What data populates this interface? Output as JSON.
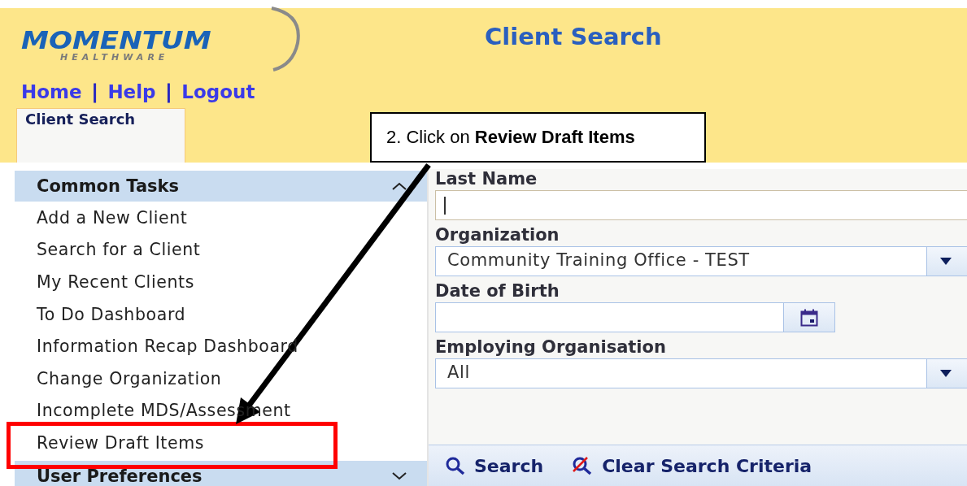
{
  "logo": {
    "name": "MOMENTUM",
    "tagline": "HEALTHWARE"
  },
  "page_title": "Client Search",
  "nav": [
    {
      "kind": "link",
      "text": "Home"
    },
    {
      "kind": "separator",
      "text": "|"
    },
    {
      "kind": "link",
      "text": "Help"
    },
    {
      "kind": "separator",
      "text": "|"
    },
    {
      "kind": "link",
      "text": "Logout"
    }
  ],
  "tabs": [
    {
      "label": "Client Search",
      "selected": true
    }
  ],
  "sidebar": {
    "sections": [
      {
        "title": "Common Tasks",
        "expanded": true,
        "items": [
          {
            "label": "Add a New Client",
            "highlighted": false
          },
          {
            "label": "Search for a Client",
            "highlighted": false
          },
          {
            "label": "My Recent Clients",
            "highlighted": false
          },
          {
            "label": "To Do Dashboard",
            "highlighted": false
          },
          {
            "label": "Information Recap Dashboard",
            "highlighted": false
          },
          {
            "label": "Change Organization",
            "highlighted": false
          },
          {
            "label": "Incomplete MDS/Assessment",
            "highlighted": false
          },
          {
            "label": "Review Draft Items",
            "highlighted": true
          }
        ]
      },
      {
        "title": "User Preferences",
        "expanded": false
      }
    ]
  },
  "form": {
    "fields": [
      {
        "kind": "text",
        "label": "Last Name",
        "focused": true
      },
      {
        "kind": "select",
        "label": "Organization",
        "value": "Community Training Office - TEST"
      },
      {
        "kind": "date",
        "label": "Date of Birth"
      },
      {
        "kind": "select",
        "label": "Employing Organisation",
        "value": "All"
      }
    ],
    "buttons": [
      {
        "kind": "search",
        "label": "Search"
      },
      {
        "kind": "clear",
        "label": "Clear Search Criteria"
      }
    ]
  },
  "callout": {
    "text": "2. Click on **Review Draft Items**"
  }
}
